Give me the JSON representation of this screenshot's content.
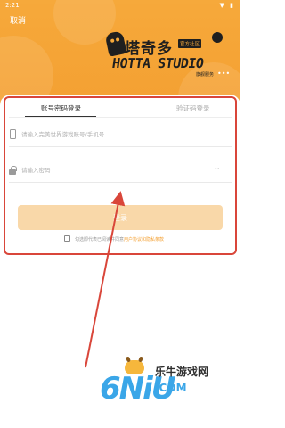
{
  "status_bar": {
    "time": "2:21",
    "icons": "▼ ▮"
  },
  "header": {
    "cancel_label": "取消"
  },
  "logo": {
    "title_cn": "塔奇多",
    "tag": "官方社区",
    "title_en": "HOTTA STUDIO",
    "sub": "旗舰服务",
    "dots": "•••"
  },
  "tabs": [
    {
      "label": "账号密码登录",
      "active": true
    },
    {
      "label": "验证码登录",
      "active": false
    }
  ],
  "account": {
    "placeholder": "请输入完美世界游戏账号/手机号",
    "value": "",
    "icon": "phone-icon"
  },
  "password": {
    "placeholder": "请输入密码",
    "value": "",
    "icon": "lock-icon",
    "toggle_icon": "eye-closed-icon",
    "toggle_glyph": "⌣"
  },
  "login_button": {
    "label": "登录"
  },
  "agreement": {
    "checked": false,
    "text_before": "勾选即代表已阅读并同意",
    "link_text": "用户协议和隐私条款"
  },
  "watermark": {
    "logo": "6NiU",
    "site_cn": "乐牛游戏网",
    "domain": ".COM"
  },
  "colors": {
    "brand_orange": "#f4a032",
    "button_disabled": "#f9d8a9",
    "annotation_red": "#d9463a",
    "watermark_blue": "#3aa6e8"
  }
}
